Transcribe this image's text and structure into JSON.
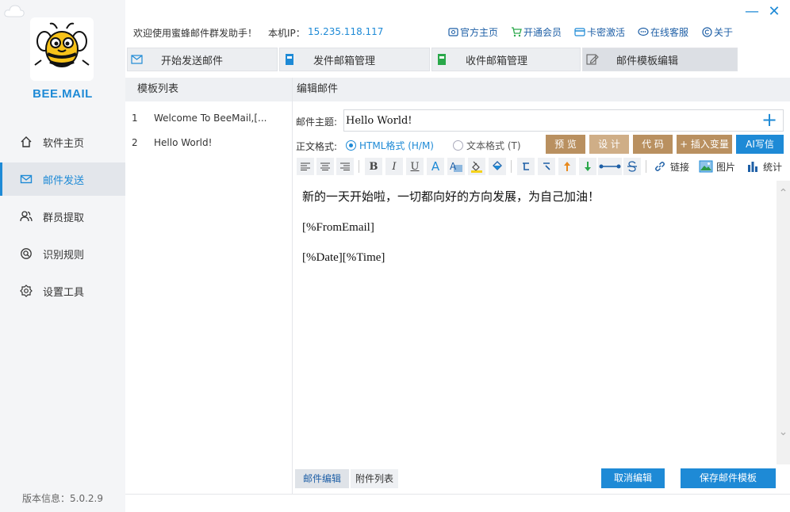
{
  "sidebar": {
    "brand": "BEE.MAIL",
    "items": [
      {
        "label": "软件主页",
        "icon": "home-icon"
      },
      {
        "label": "邮件发送",
        "icon": "mail-icon",
        "active": true
      },
      {
        "label": "群员提取",
        "icon": "users-icon"
      },
      {
        "label": "识别规则",
        "icon": "magnifier-icon"
      },
      {
        "label": "设置工具",
        "icon": "gear-icon"
      }
    ],
    "version": "版本信息：5.0.2.9"
  },
  "topbar": {
    "welcome": "欢迎使用蜜蜂邮件群发助手！",
    "ip_label": "本机IP：",
    "ip_value": "15.235.118.117",
    "links": [
      {
        "label": "官方主页",
        "icon": "home-page-icon"
      },
      {
        "label": "开通会员",
        "icon": "cart-icon"
      },
      {
        "label": "卡密激活",
        "icon": "card-icon"
      },
      {
        "label": "在线客服",
        "icon": "chat-icon"
      },
      {
        "label": "关于",
        "icon": "copyright-icon"
      }
    ]
  },
  "tabs": [
    {
      "label": "开始发送邮件",
      "icon": "send-mail-icon"
    },
    {
      "label": "发件邮箱管理",
      "icon": "outbox-icon"
    },
    {
      "label": "收件邮箱管理",
      "icon": "inbox-icon"
    },
    {
      "label": "邮件模板编辑",
      "icon": "edit-icon",
      "active": true
    }
  ],
  "template_list": {
    "header": "模板列表",
    "items": [
      {
        "num": "1",
        "name": "Welcome To BeeMail,[..."
      },
      {
        "num": "2",
        "name": "Hello World!"
      }
    ]
  },
  "editor": {
    "header": "编辑邮件",
    "subject_label": "邮件主题:",
    "subject_value": "Hello World!",
    "format_label": "正文格式:",
    "format_html": "HTML格式 (H/M)",
    "format_text": "文本格式 (T)",
    "buttons": {
      "preview": "预 览",
      "design": "设 计",
      "code": "代 码",
      "insert_var": "+ 插入变量",
      "ai": "AI写信"
    },
    "toolbar": {
      "link": "链接",
      "image": "图片",
      "stats": "统计"
    },
    "body": [
      "新的一天开始啦，一切都向好的方向发展，为自己加油！",
      "[%FromEmail]",
      "[%Date][%Time]"
    ]
  },
  "bottom": {
    "tab_edit": "邮件编辑",
    "tab_attach": "附件列表",
    "cancel": "取消编辑",
    "save": "保存邮件模板"
  },
  "colors": {
    "accent": "#1e8ad6",
    "button_brown": "#b99060",
    "button_tan": "#cfae87"
  }
}
